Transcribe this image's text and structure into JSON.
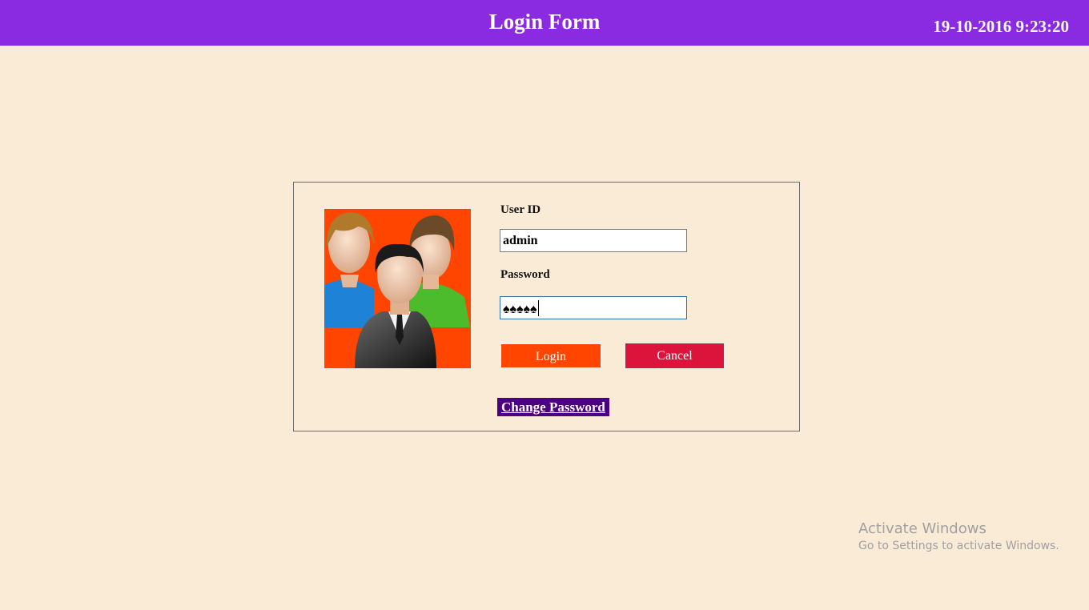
{
  "header": {
    "title": "Login Form",
    "datetime": "19-10-2016 9:23:20"
  },
  "form": {
    "user_id_label": "User ID",
    "user_id_value": "admin",
    "password_label": "Password",
    "password_masked": "♠♠♠♠♠",
    "login_label": "Login",
    "cancel_label": "Cancel",
    "change_password_label": "Change Password"
  },
  "avatar": {
    "icon": "users-group-icon",
    "background": "#ff4500"
  },
  "watermark": {
    "title": "Activate Windows",
    "subtitle": "Go to Settings to activate Windows."
  },
  "colors": {
    "titlebar": "#8a2be2",
    "page_background": "#faebd7",
    "login_button": "#ff4500",
    "cancel_button": "#dc143c",
    "change_password_bg": "#4b0082"
  }
}
